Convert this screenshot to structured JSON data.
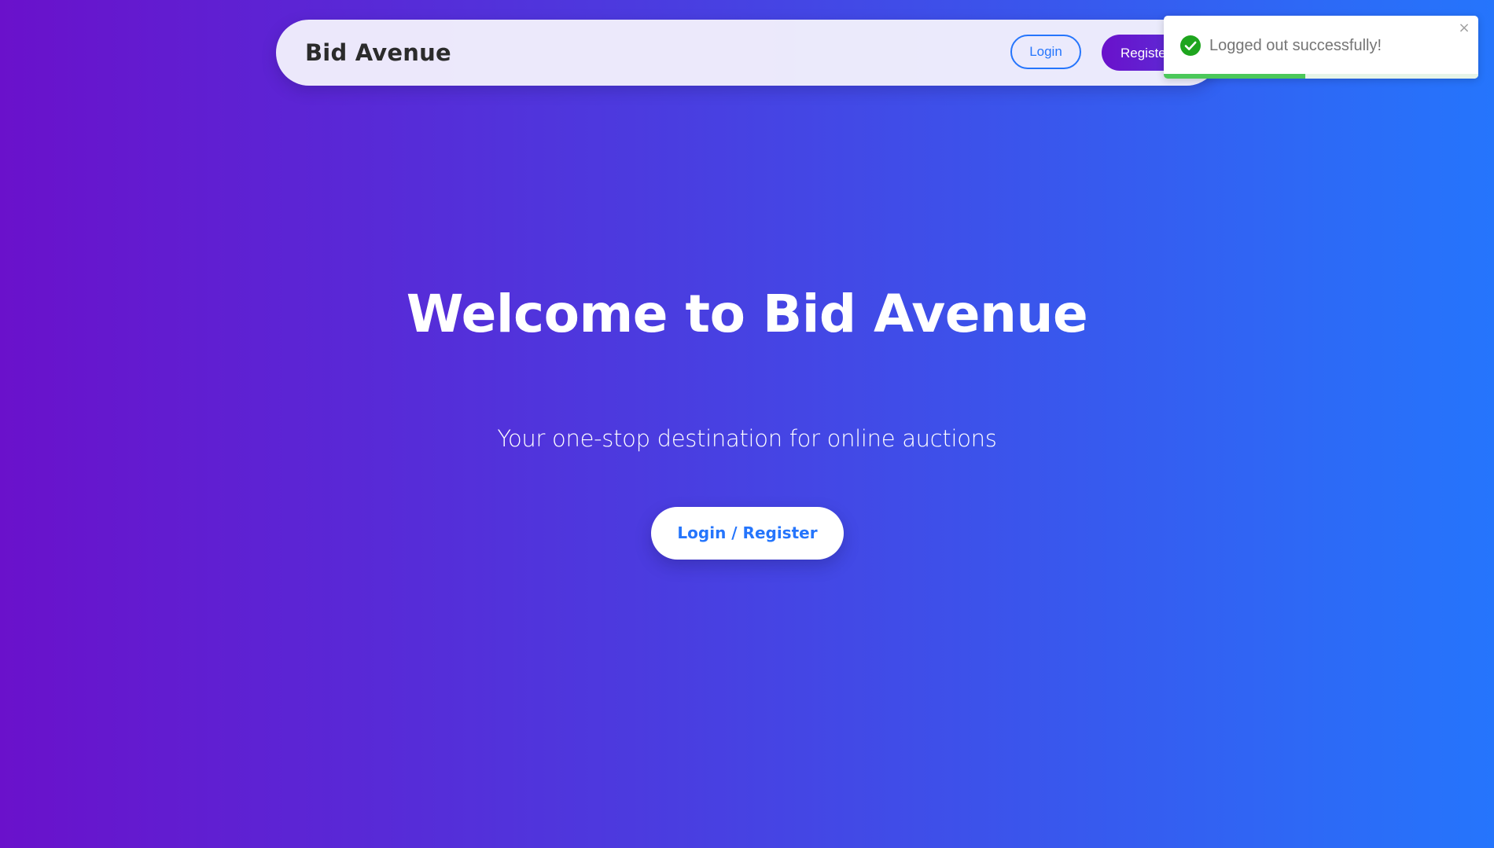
{
  "navbar": {
    "brand": "Bid Avenue",
    "login_label": "Login",
    "register_label": "Register"
  },
  "hero": {
    "title": "Welcome to Bid Avenue",
    "subtitle": "Your one-stop destination for online auctions",
    "cta_label": "Login / Register"
  },
  "toast": {
    "message": "Logged out successfully!",
    "status": "success",
    "icon": "check-circle-icon",
    "close_icon": "close-icon",
    "close_glyph": "×",
    "progress_remaining": 0.45
  },
  "colors": {
    "gradient_start": "#6a11cb",
    "gradient_end": "#2575fc",
    "accent": "#2575fc",
    "success": "#4bc85a",
    "success_icon": "#1ea51e"
  }
}
